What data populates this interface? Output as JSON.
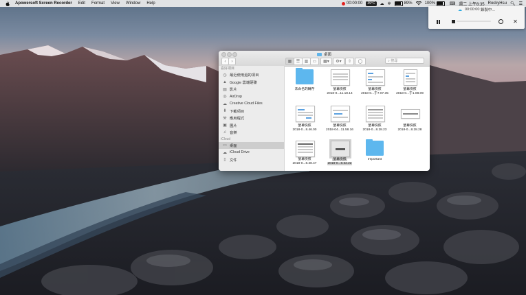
{
  "menubar": {
    "app_name": "Apowersoft Screen Recorder",
    "menus": [
      "Edit",
      "Format",
      "View",
      "Window",
      "Help"
    ],
    "rec_time": "00:00:00",
    "temp_badge": "39°C",
    "battery_pct_left": "89%",
    "battery_pct_right": "100%",
    "datetime": "週二 上午8:35",
    "username": "RockyHsu"
  },
  "recorder": {
    "status_time": "00:00:00",
    "status_label": "錄製中...",
    "icons": [
      "pause-icon",
      "stop-icon",
      "screenshot-icon",
      "close-icon"
    ]
  },
  "finder": {
    "window_title": "桌面",
    "search_placeholder": "搜尋",
    "sidebar": {
      "favorites_header": "喜好項目",
      "favorites": [
        {
          "label": "最近使用過的項目",
          "icon": "clock-icon"
        },
        {
          "label": "Google 雲端硬碟",
          "icon": "drive-icon"
        },
        {
          "label": "影片",
          "icon": "film-icon"
        },
        {
          "label": "AirDrop",
          "icon": "airdrop-icon"
        },
        {
          "label": "Creative Cloud Files",
          "icon": "creative-cloud-icon"
        },
        {
          "label": "下載項目",
          "icon": "download-icon"
        },
        {
          "label": "應用程式",
          "icon": "apps-icon"
        },
        {
          "label": "圖片",
          "icon": "pictures-icon"
        },
        {
          "label": "音樂",
          "icon": "music-icon"
        }
      ],
      "icloud_header": "iCloud",
      "icloud": [
        {
          "label": "桌面",
          "icon": "desktop-icon",
          "selected": true
        },
        {
          "label": "iCloud Drive",
          "icon": "cloud-icon"
        },
        {
          "label": "文件",
          "icon": "documents-icon"
        }
      ]
    },
    "files": [
      {
        "name": "未命名的轉存",
        "date": "",
        "kind": "folder"
      },
      {
        "name": "螢幕快照",
        "date": "2018-0...11.18.14",
        "kind": "doc"
      },
      {
        "name": "螢幕快照",
        "date": "2018-0...于7.07.35",
        "kind": "doc"
      },
      {
        "name": "螢幕快照",
        "date": "2018-0...于1.08.09",
        "kind": "doc-tall"
      },
      {
        "name": "螢幕快照",
        "date": "2018-0...8.46.00",
        "kind": "doc"
      },
      {
        "name": "螢幕快照",
        "date": "2018-04...11.58.16",
        "kind": "doc"
      },
      {
        "name": "螢幕快照",
        "date": "2018-0...8.28.23",
        "kind": "doc"
      },
      {
        "name": "螢幕快照",
        "date": "2018-0...8.28.28",
        "kind": "doc-wide"
      },
      {
        "name": "螢幕快照",
        "date": "2018-0...8.28.47",
        "kind": "doc"
      },
      {
        "name": "螢幕快照",
        "date": "2018-0...8.32.22",
        "kind": "doc-dark",
        "selected": true
      },
      {
        "name": "Important",
        "date": "",
        "kind": "folder"
      }
    ]
  }
}
